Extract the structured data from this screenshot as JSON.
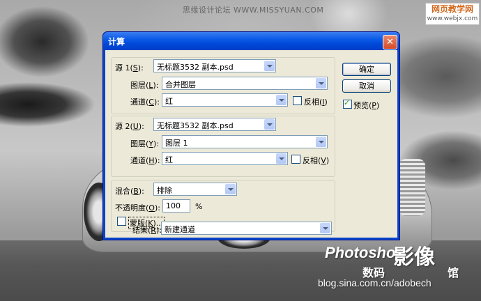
{
  "watermark": {
    "top_text": "思缘设计论坛 WWW.MISSYUAN.COM",
    "logo_line1": "网页教学网",
    "logo_line2": "www.webjx.com",
    "brand": "Photoshop",
    "brand_big": "影像",
    "brand_digital": "数码",
    "brand_hall": "馆",
    "url": "blog.sina.com.cn/adobech"
  },
  "dialog": {
    "title": "计算",
    "close_glyph": "✕",
    "source1": {
      "label_prefix": "源 1(",
      "label_key": "S",
      "label_suffix": "):",
      "file": "无标题3532 副本.psd",
      "layer_prefix": "图层(",
      "layer_key": "L",
      "layer_suffix": "):",
      "layer_value": "合并图层",
      "channel_prefix": "通道(",
      "channel_key": "C",
      "channel_suffix": "):",
      "channel_value": "红",
      "invert_prefix": "反相(",
      "invert_key": "I",
      "invert_suffix": ")",
      "invert_checked": false
    },
    "source2": {
      "label_prefix": "源 2(",
      "label_key": "U",
      "label_suffix": "):",
      "file": "无标题3532 副本.psd",
      "layer_prefix": "图层(",
      "layer_key": "Y",
      "layer_suffix": "):",
      "layer_value": "图层 1",
      "channel_prefix": "通道(",
      "channel_key": "H",
      "channel_suffix": "):",
      "channel_value": "红",
      "invert_prefix": "反相(",
      "invert_key": "V",
      "invert_suffix": ")",
      "invert_checked": false
    },
    "blending": {
      "label_prefix": "混合(",
      "label_key": "B",
      "label_suffix": "):",
      "mode": "排除",
      "opacity_prefix": "不透明度(",
      "opacity_key": "O",
      "opacity_suffix": "):",
      "opacity_value": "100",
      "opacity_unit": "%",
      "mask_prefix": "蒙版(",
      "mask_key": "K",
      "mask_suffix": ")...",
      "mask_checked": false
    },
    "result": {
      "label_prefix": "结果(",
      "label_key": "R",
      "label_suffix": "):",
      "value": "新建通道"
    },
    "buttons": {
      "ok": "确定",
      "cancel": "取消"
    },
    "preview": {
      "prefix": "预览(",
      "key": "P",
      "suffix": ")",
      "checked": true
    }
  }
}
